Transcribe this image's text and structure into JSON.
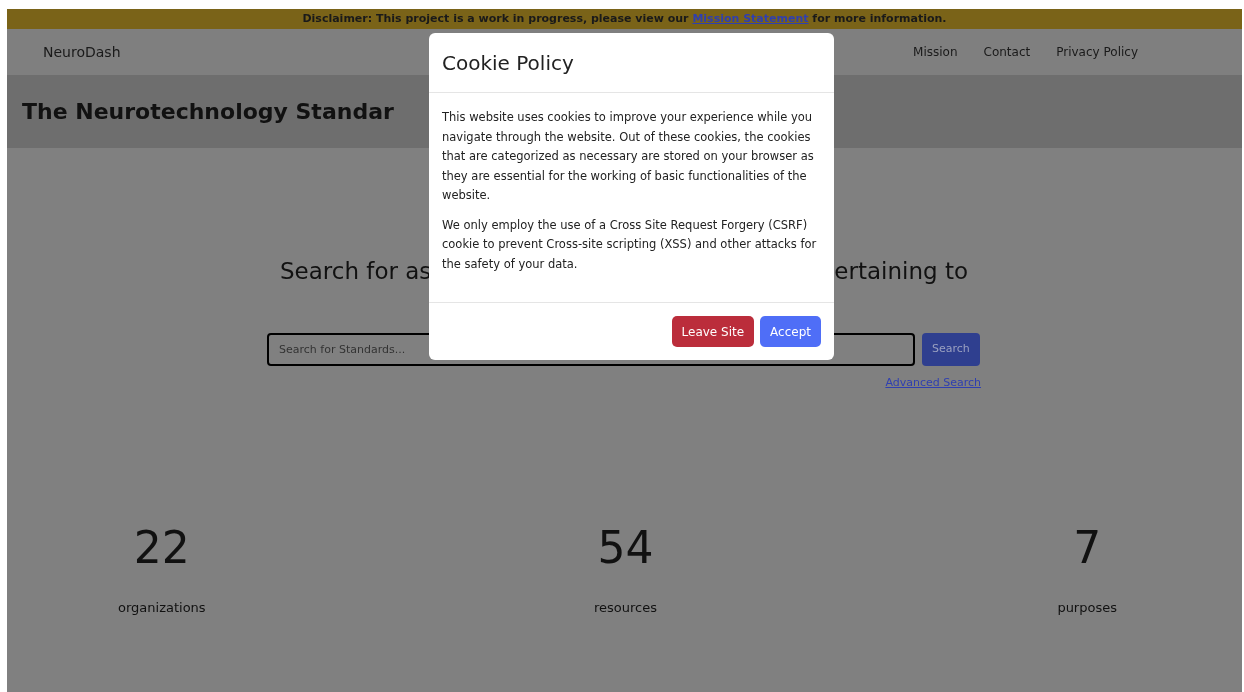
{
  "disclaimer": {
    "before": "Disclaimer: This project is a work in progress, please view our ",
    "link": "Mission Statement",
    "after": " for more information."
  },
  "navbar": {
    "brand": "NeuroDash",
    "links": [
      "Mission",
      "Contact",
      "Privacy Policy"
    ]
  },
  "page_title": "The Neurotechnology Standar",
  "search_heading": {
    "left": "Search for as",
    "right": "ertaining to"
  },
  "search": {
    "placeholder": "Search for Standards...",
    "button": "Search",
    "advanced_link": "Advanced Search"
  },
  "stats": [
    {
      "value": "22",
      "label": "organizations"
    },
    {
      "value": "54",
      "label": "resources"
    },
    {
      "value": "7",
      "label": "purposes"
    }
  ],
  "modal": {
    "title": "Cookie Policy",
    "paragraphs": [
      "This website uses cookies to improve your experience while you navigate through the website. Out of these cookies, the cookies that are categorized as necessary are stored on your browser as they are essential for the working of basic functionalities of the website.",
      "We only employ the use of a Cross Site Request Forgery (CSRF) cookie to prevent Cross-site scripting (XSS) and other attacks for the safety of your data."
    ],
    "buttons": [
      {
        "label": "Leave Site",
        "kind": "danger"
      },
      {
        "label": "Accept",
        "kind": "primary"
      }
    ]
  }
}
